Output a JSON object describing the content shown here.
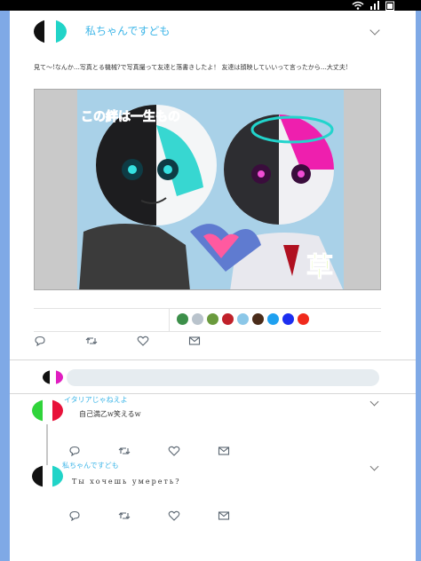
{
  "status_bar": {
    "icons": [
      "wifi-icon",
      "signal-icon",
      "battery-icon"
    ]
  },
  "post": {
    "author": "私ちゃんですども",
    "avatar_colors": [
      "#111111",
      "#ffffff",
      "#21d4c8"
    ],
    "text": "見て～!なんか…写真とる機械?で写真撮って友達と落書きしたよ！ 友達は顔映していいって言ったから…大丈夫!",
    "artwork_text": [
      "この絆は一生もの",
      "草"
    ],
    "emoji_reactions": [
      "globe",
      "cloud",
      "landscape",
      "red-face",
      "sky",
      "brown-circle",
      "blue-circle",
      "deep-blue-circle",
      "red-circle"
    ],
    "emoji_colors": [
      "#3c8f4a",
      "#b9c3cc",
      "#6a9a3d",
      "#c0212a",
      "#8bc7e8",
      "#4a2c1a",
      "#1ea0f0",
      "#1c2ef0",
      "#f02a1c"
    ]
  },
  "reply_box": {
    "avatar_colors": [
      "#111111",
      "#ffffff",
      "#e01ec0"
    ]
  },
  "replies": [
    {
      "author": "イタリアじゃねえよ",
      "text": "自己満乙w笑えるw",
      "avatar_colors": [
        "#2fd43a",
        "#ffffff",
        "#e8123a"
      ]
    },
    {
      "author": "私ちゃんですども",
      "text": "Ты хочешь умереть?",
      "avatar_colors": [
        "#111111",
        "#ffffff",
        "#21d4c8"
      ]
    }
  ],
  "action_icons": [
    "reply-icon",
    "retweet-icon",
    "like-icon",
    "share-icon"
  ]
}
